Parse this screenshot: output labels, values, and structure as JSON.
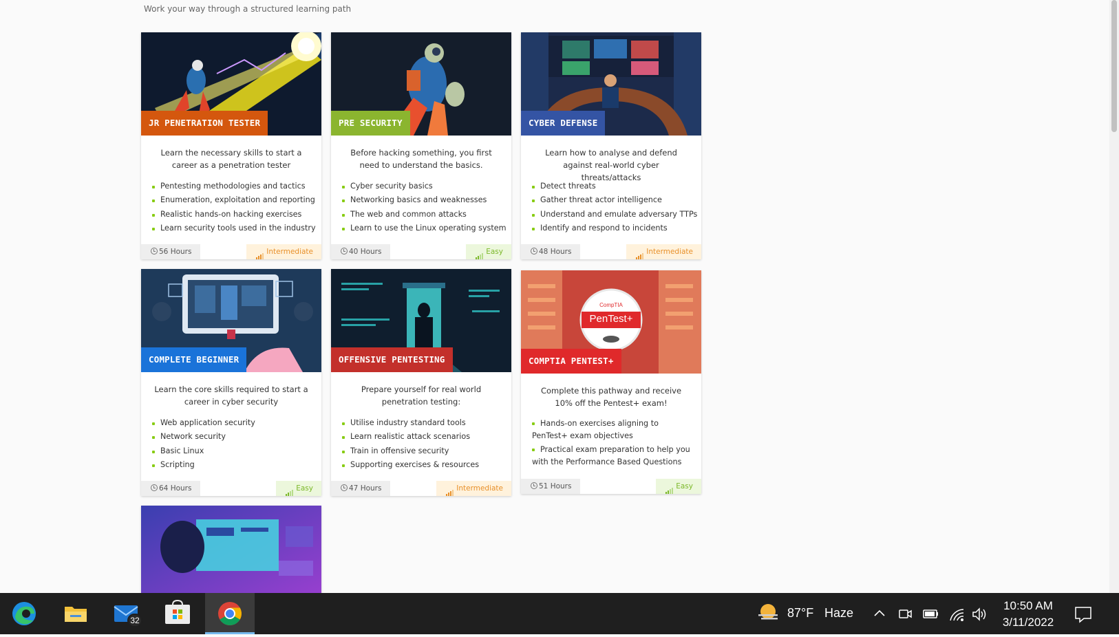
{
  "page": {
    "subtitle": "Work your way through a structured learning path"
  },
  "cards": [
    {
      "tag": "JR PENETRATION TESTER",
      "tag_color": "#d4570e",
      "description": "Learn the necessary skills to start a career as a penetration tester",
      "items": [
        "Pentesting methodologies and tactics",
        "Enumeration, exploitation and reporting",
        "Realistic hands-on hacking exercises",
        "Learn security tools used in the industry"
      ],
      "hours": "56 Hours",
      "level": "Intermediate"
    },
    {
      "tag": "PRE SECURITY",
      "tag_color": "#8bb52f",
      "description": "Before hacking something, you first need to understand the basics.",
      "items": [
        "Cyber security basics",
        "Networking basics and weaknesses",
        "The web and common attacks",
        "Learn to use the Linux operating system"
      ],
      "hours": "40 Hours",
      "level": "Easy"
    },
    {
      "tag": "CYBER DEFENSE",
      "tag_color": "#3454a4",
      "description": "Learn how to analyse and defend against real-world cyber threats/attacks",
      "items": [
        "Detect threats",
        "Gather threat actor intelligence",
        "Understand and emulate adversary TTPs",
        "Identify and respond to incidents"
      ],
      "hours": "48 Hours",
      "level": "Intermediate"
    },
    {
      "tag": "COMPLETE BEGINNER",
      "tag_color": "#1a73d9",
      "description": "Learn the core skills required to start a career in cyber security",
      "items": [
        "Web application security",
        "Network security",
        "Basic Linux",
        "Scripting"
      ],
      "hours": "64 Hours",
      "level": "Easy"
    },
    {
      "tag": "OFFENSIVE PENTESTING",
      "tag_color": "#c3302b",
      "description": "Prepare yourself for real world penetration testing:",
      "items": [
        "Utilise industry standard tools",
        "Learn realistic attack scenarios",
        "Train in offensive security",
        "Supporting exercises & resources"
      ],
      "hours": "47 Hours",
      "level": "Intermediate"
    },
    {
      "tag": "COMPTIA PENTEST+",
      "tag_color": "#e0292b",
      "description": "Complete this pathway and receive 10% off the Pentest+ exam!",
      "items": [
        "Hands-on exercises aligning to PenTest+ exam objectives",
        "Practical exam preparation to help you with the Performance Based Questions"
      ],
      "hours": "51 Hours",
      "level": "Easy",
      "logo_top": "CompTIA",
      "logo_main": "PenTest+"
    }
  ],
  "colors": {
    "bullet": "#88cc14",
    "intermediate": "#e8902a",
    "easy": "#7cb82a"
  },
  "taskbar": {
    "apps": [
      "edge-icon",
      "file-explorer-icon",
      "mail-icon",
      "microsoft-store-icon",
      "chrome-icon"
    ],
    "mail_badge": "32",
    "weather_temp": "87°F",
    "weather_desc": "Haze",
    "time": "10:50 AM",
    "date": "3/11/2022"
  }
}
